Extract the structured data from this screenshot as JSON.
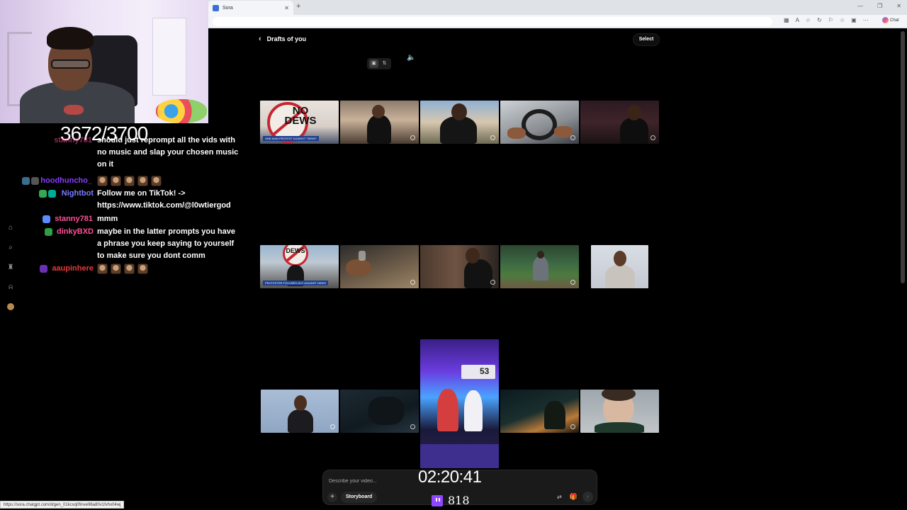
{
  "browser": {
    "tab_title": "Sora",
    "tab_close": "✕",
    "new_tab": "+",
    "window_controls": [
      "—",
      "❐",
      "✕"
    ],
    "toolbar_icons": [
      "▦",
      "A",
      "☆",
      "↻",
      "⚐",
      "☆",
      "▣",
      "⋯"
    ],
    "chat_label": "Chat",
    "status_url": "https://sora.chatgpt.com/d/gen_01kcxq0finve96a80v1fvhx04wj"
  },
  "stream": {
    "goal_counter": "3672/3700",
    "timer": "02:20:41",
    "viewer_count": "818"
  },
  "chat": [
    {
      "user": "stanny781",
      "text": "should just reprompt all the vids with no music and slap your chosen music on it",
      "color": "#ff4f9a",
      "badges": []
    },
    {
      "user": "hoodhuncho_",
      "text": "",
      "emotes": 5,
      "color": "#8a3dff",
      "badges": [
        "#3b6d8f",
        "#555"
      ]
    },
    {
      "user": "Nightbot",
      "text": "Follow me on TikTok! -> https://www.tiktok.com/@l0wtiergod",
      "color": "#7c7cff",
      "badges": [
        "#34a853",
        "#00ad96"
      ]
    },
    {
      "user": "stanny781",
      "text": "mmm",
      "color": "#ff4f9a",
      "badges": [
        "#5b8cff"
      ]
    },
    {
      "user": "dinkyBXD",
      "text": "maybe in the latter prompts you have a phrase you keep saying to yourself to make sure you dont comm",
      "color": "#ff4f9a",
      "badges": [
        "#2f9e44"
      ]
    },
    {
      "user": "aaupinhere",
      "text": "",
      "emotes": 4,
      "color": "#e33b3b",
      "badges": [
        "#6b2fb3"
      ]
    }
  ],
  "rail_icons": [
    "home-icon",
    "search-icon",
    "trophy-icon",
    "bell-icon",
    "profile-avatar"
  ],
  "rail_glyphs": [
    "⌂",
    "⌕",
    "♜",
    "⍾",
    ""
  ],
  "sora": {
    "back_label": "Drafts of you",
    "select_label": "Select",
    "prompt_placeholder": "Describe your video...",
    "storyboard_label": "Storyboard",
    "plus_label": "+",
    "settings_glyph": "⇄",
    "gift_glyph": "🎁",
    "submit_glyph": "↑",
    "mute_glyph": "🔈",
    "view_glyphs": [
      "▣",
      "⇅"
    ]
  },
  "thumbs": {
    "nodews_sign": "NO DEWS",
    "nodews_ticker": "ONE-MAN PROTEST AGAINST \"DEWS\"",
    "street_sign": "DEWS",
    "street_ticker": "PROTESTER FOCUSES OUT AGAINST DEWS",
    "fight_score": "53"
  }
}
